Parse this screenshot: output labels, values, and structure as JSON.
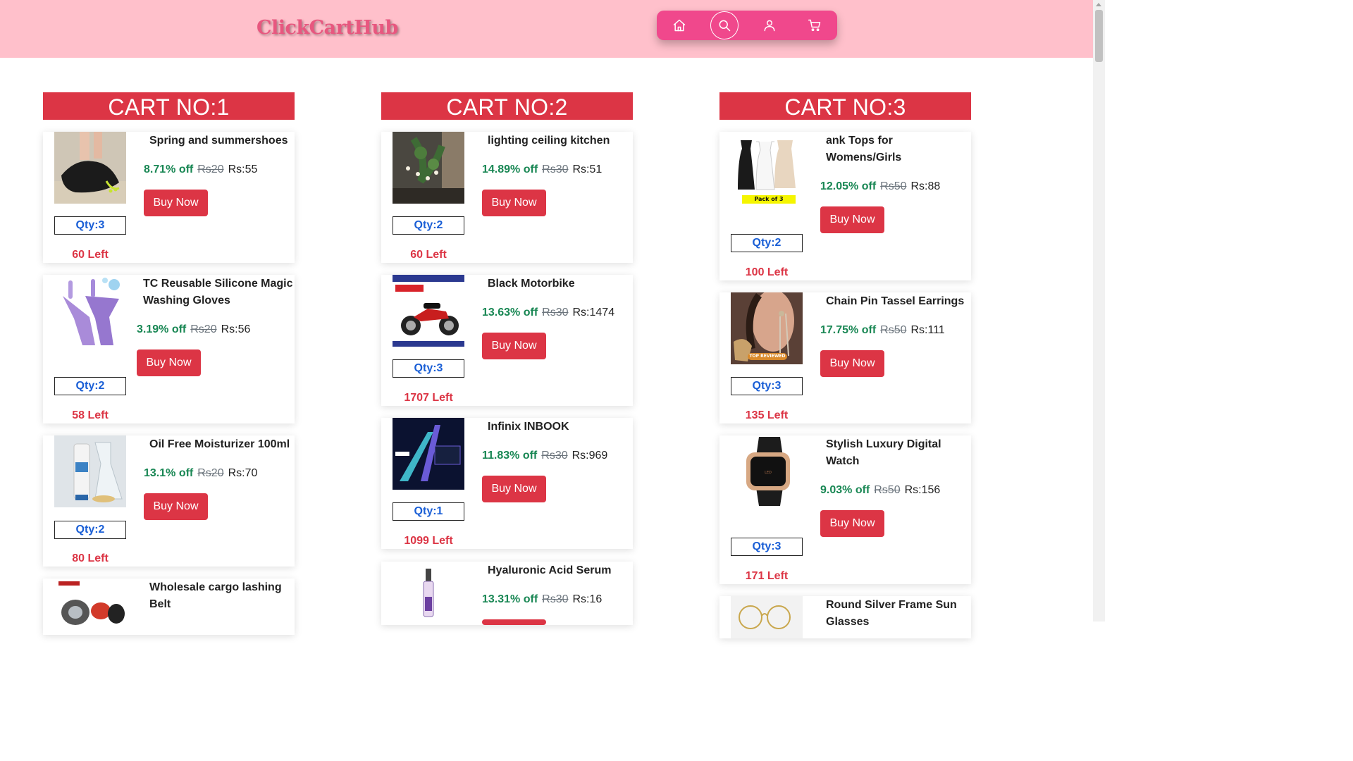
{
  "header": {
    "logo": "ClickCartHub",
    "nav": [
      {
        "icon": "home-icon"
      },
      {
        "icon": "search-icon"
      },
      {
        "icon": "user-icon"
      },
      {
        "icon": "cart-icon"
      }
    ]
  },
  "colors": {
    "header_bg": "#ffc0cb",
    "nav_bg": "#f0488c",
    "accent_red": "#dc3545",
    "discount_green": "#198754",
    "qty_blue": "#1a5fd6"
  },
  "carts": [
    {
      "title": "CART NO:1",
      "items": [
        {
          "name": "Spring and summershoes",
          "discount": "8.71% off",
          "old_price": "Rs20",
          "price": "Rs:55",
          "buy": "Buy Now",
          "qty": "Qty:3",
          "left": "60 Left",
          "image": "black water shoes on sand"
        },
        {
          "name": "TC Reusable Silicone Magic Washing Gloves",
          "discount": "3.19% off",
          "old_price": "Rs20",
          "price": "Rs:56",
          "buy": "Buy Now",
          "qty": "Qty:2",
          "left": "58 Left",
          "image": "purple silicone gloves"
        },
        {
          "name": "Oil Free Moisturizer 100ml",
          "discount": "13.1% off",
          "old_price": "Rs20",
          "price": "Rs:70",
          "buy": "Buy Now",
          "qty": "Qty:2",
          "left": "80 Left",
          "image": "moisturizer tube"
        },
        {
          "name": "Wholesale cargo lashing Belt",
          "discount": "",
          "old_price": "",
          "price": "",
          "buy": "",
          "qty": "",
          "left": "",
          "image": "cargo belts"
        }
      ]
    },
    {
      "title": "CART NO:2",
      "items": [
        {
          "name": "lighting ceiling kitchen",
          "discount": "14.89% off",
          "old_price": "Rs30",
          "price": "Rs:51",
          "buy": "Buy Now",
          "qty": "Qty:2",
          "left": "60 Left",
          "image": "ceiling lights with plants"
        },
        {
          "name": "Black Motorbike",
          "discount": "13.63% off",
          "old_price": "Rs30",
          "price": "Rs:1474",
          "buy": "Buy Now",
          "qty": "Qty:3",
          "left": "1707 Left",
          "image": "motorbike poster"
        },
        {
          "name": "Infinix INBOOK",
          "discount": "11.83% off",
          "old_price": "Rs30",
          "price": "Rs:969",
          "buy": "Buy Now",
          "qty": "Qty:1",
          "left": "1099 Left",
          "image": "laptop ad"
        },
        {
          "name": "Hyaluronic Acid Serum",
          "discount": "13.31% off",
          "old_price": "Rs30",
          "price": "Rs:16",
          "buy": "",
          "qty": "",
          "left": "",
          "image": "serum bottle"
        }
      ]
    },
    {
      "title": "CART NO:3",
      "items": [
        {
          "name": "ank Tops for Womens/Girls",
          "discount": "12.05% off",
          "old_price": "Rs50",
          "price": "Rs:88",
          "buy": "Buy Now",
          "qty": "Qty:2",
          "left": "100 Left",
          "image": "tank tops pack of 3",
          "image_label": "Pack of 3"
        },
        {
          "name": "Chain Pin Tassel Earrings",
          "discount": "17.75% off",
          "old_price": "Rs50",
          "price": "Rs:111",
          "buy": "Buy Now",
          "qty": "Qty:3",
          "left": "135 Left",
          "image": "earrings",
          "image_label": "TOP REVIEWED"
        },
        {
          "name": "Stylish Luxury Digital Watch",
          "discount": "9.03% off",
          "old_price": "Rs50",
          "price": "Rs:156",
          "buy": "Buy Now",
          "qty": "Qty:3",
          "left": "171 Left",
          "image": "digital watch"
        },
        {
          "name": "Round Silver Frame Sun Glasses",
          "discount": "",
          "old_price": "",
          "price": "",
          "buy": "",
          "qty": "",
          "left": "",
          "image": "sunglasses"
        }
      ]
    }
  ]
}
